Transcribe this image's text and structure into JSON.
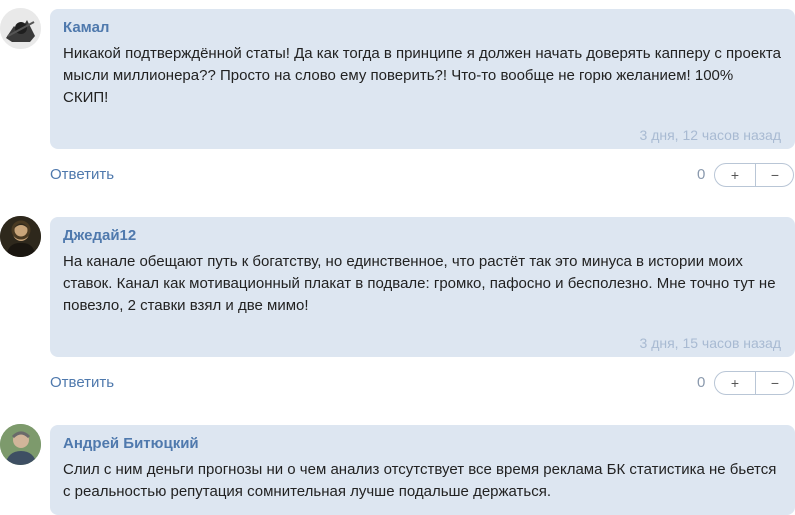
{
  "comments": [
    {
      "author": "Камал",
      "text": "Никакой подтверждённой статы! Да как тогда в принципе я должен начать доверять капперу с проекта мысли миллионера?? Просто на слово ему поверить?! Что-то вообще не горю желанием! 100% СКИП!",
      "time": "3 дня, 12 часов назад",
      "reply": "Ответить",
      "score": "0",
      "plus": "+",
      "minus": "−"
    },
    {
      "author": "Джедай12",
      "text": "На канале обещают путь к богатству, но единственное, что растёт так это минуса в истории моих ставок. Канал как мотивационный плакат в подвале: громко, пафосно и бесполезно. Мне точно тут не повезло, 2 ставки взял и две мимо!",
      "time": "3 дня, 15 часов назад",
      "reply": "Ответить",
      "score": "0",
      "plus": "+",
      "minus": "−"
    },
    {
      "author": "Андрей Битюцкий",
      "text": "Слил с ним деньги прогнозы ни о чем анализ отсутствует все время реклама БК статистика не бьется с реальностью репутация сомнительная лучше подальше держаться."
    }
  ]
}
